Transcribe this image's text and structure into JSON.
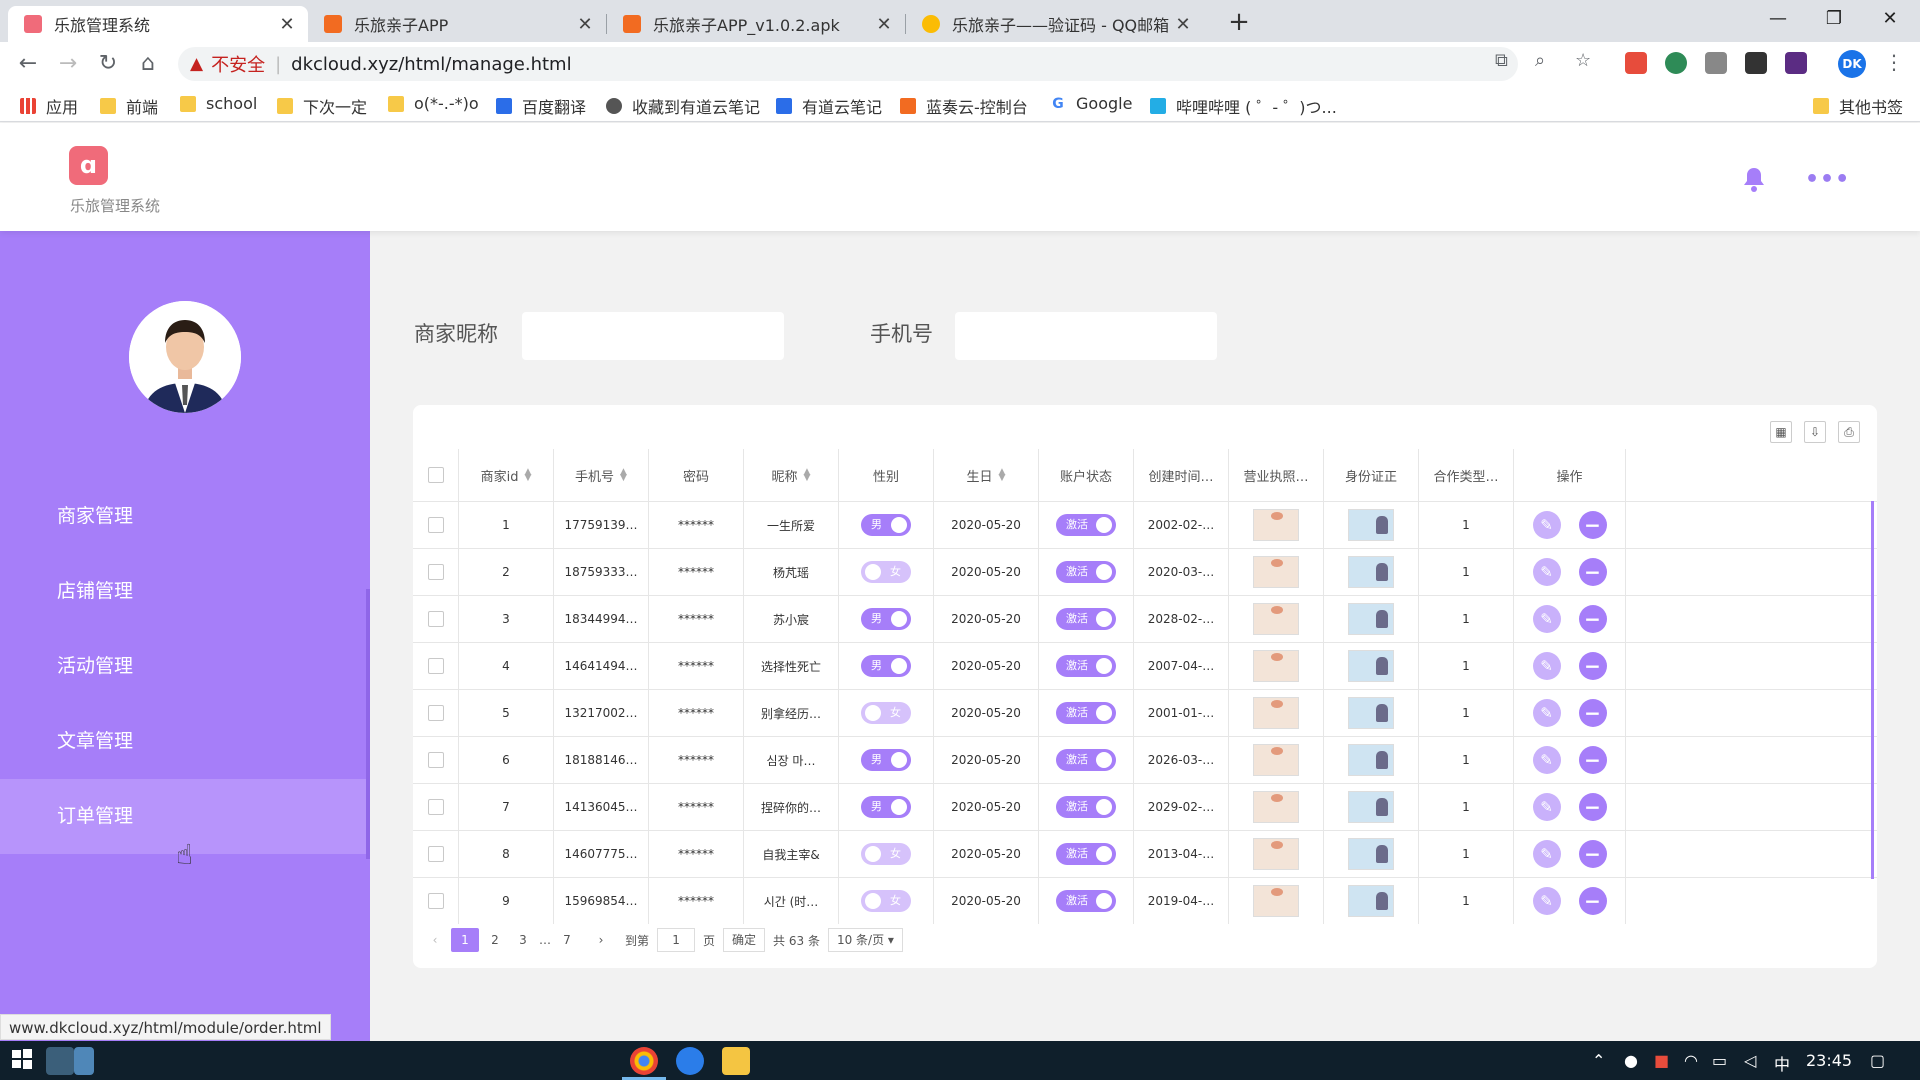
{
  "browser": {
    "tabs": [
      {
        "title": "乐旅管理系统",
        "active": true
      },
      {
        "title": "乐旅亲子APP",
        "active": false
      },
      {
        "title": "乐旅亲子APP_v1.0.2.apk",
        "active": false
      },
      {
        "title": "乐旅亲子——验证码 - QQ邮箱",
        "active": false
      }
    ],
    "security_label": "不安全",
    "url": "dkcloud.xyz/html/manage.html",
    "profile_initials": "DK",
    "bookmarks": [
      "应用",
      "前端",
      "school",
      "下次一定",
      "o(*-.-*)o",
      "百度翻译",
      "收藏到有道云笔记",
      "有道云笔记",
      "蓝奏云-控制台",
      "Google",
      "哔哩哔哩 ( ゜- ゜)つ..."
    ],
    "other_bookmarks": "其他书签",
    "status_url": "www.dkcloud.xyz/html/module/order.html"
  },
  "app": {
    "name": "乐旅管理系统",
    "accent_color": "#a67ef9"
  },
  "sidebar": {
    "items": [
      {
        "label": "商家管理"
      },
      {
        "label": "店铺管理"
      },
      {
        "label": "活动管理"
      },
      {
        "label": "文章管理"
      },
      {
        "label": "订单管理",
        "active": true
      }
    ]
  },
  "filters": {
    "nickname_label": "商家昵称",
    "nickname_value": "",
    "phone_label": "手机号",
    "phone_value": ""
  },
  "table": {
    "columns": [
      "商家id",
      "手机号",
      "密码",
      "昵称",
      "性别",
      "生日",
      "账户状态",
      "创建时间…",
      "营业执照…",
      "身份证正",
      "合作类型…",
      "操作"
    ],
    "status_label": "激活",
    "rows": [
      {
        "id": "1",
        "phone": "17759139…",
        "password": "******",
        "nickname": "一生所爱",
        "gender": "男",
        "birthday": "2020-05-20",
        "created": "2002-02-…",
        "coop": "1"
      },
      {
        "id": "2",
        "phone": "18759333…",
        "password": "******",
        "nickname": "杨芃瑶",
        "gender": "女",
        "birthday": "2020-05-20",
        "created": "2020-03-…",
        "coop": "1"
      },
      {
        "id": "3",
        "phone": "18344994…",
        "password": "******",
        "nickname": "苏小宸",
        "gender": "男",
        "birthday": "2020-05-20",
        "created": "2028-02-…",
        "coop": "1"
      },
      {
        "id": "4",
        "phone": "14641494…",
        "password": "******",
        "nickname": "选择性死亡",
        "gender": "男",
        "birthday": "2020-05-20",
        "created": "2007-04-…",
        "coop": "1"
      },
      {
        "id": "5",
        "phone": "13217002…",
        "password": "******",
        "nickname": "别拿经历…",
        "gender": "女",
        "birthday": "2020-05-20",
        "created": "2001-01-…",
        "coop": "1"
      },
      {
        "id": "6",
        "phone": "18188146…",
        "password": "******",
        "nickname": "심장 마…",
        "gender": "男",
        "birthday": "2020-05-20",
        "created": "2026-03-…",
        "coop": "1"
      },
      {
        "id": "7",
        "phone": "14136045…",
        "password": "******",
        "nickname": "捏碎你的…",
        "gender": "男",
        "birthday": "2020-05-20",
        "created": "2029-02-…",
        "coop": "1"
      },
      {
        "id": "8",
        "phone": "14607775…",
        "password": "******",
        "nickname": "自我主宰&",
        "gender": "女",
        "birthday": "2020-05-20",
        "created": "2013-04-…",
        "coop": "1"
      },
      {
        "id": "9",
        "phone": "15969854…",
        "password": "******",
        "nickname": "시간 (时…",
        "gender": "女",
        "birthday": "2020-05-20",
        "created": "2019-04-…",
        "coop": "1"
      }
    ]
  },
  "pagination": {
    "pages": [
      "1",
      "2",
      "3",
      "…",
      "7"
    ],
    "current": "1",
    "goto_label": "到第",
    "goto_value": "1",
    "page_unit": "页",
    "confirm_label": "确定",
    "total_label": "共 63 条",
    "page_size": "10 条/页"
  },
  "taskbar": {
    "ime": "中",
    "clock": "23:45"
  }
}
